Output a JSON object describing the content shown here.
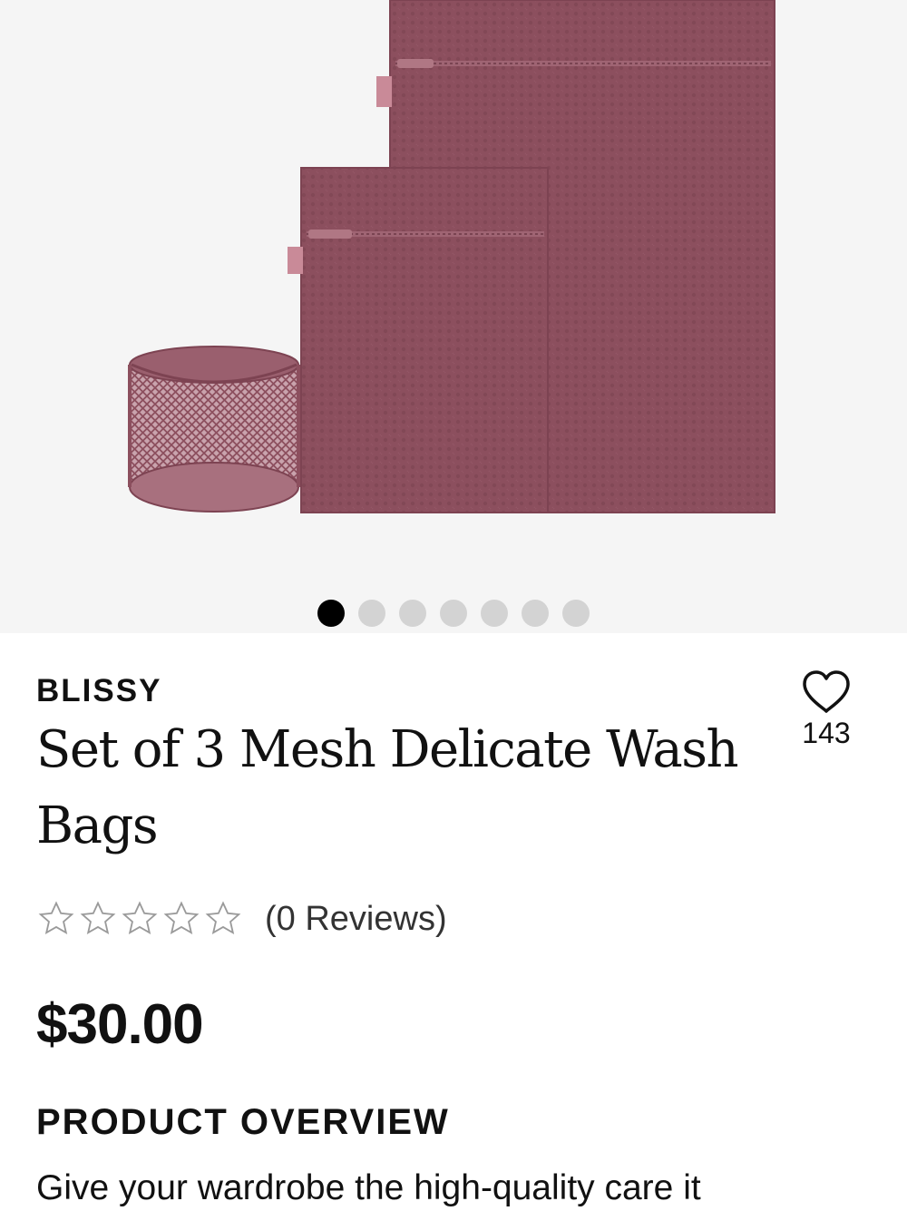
{
  "gallery": {
    "image_alt": "Set of 3 Mesh Delicate Wash Bags product photo",
    "product_color": "#8c4f5e",
    "background_color": "#f5f5f5",
    "slide_count": 7,
    "active_slide": 1
  },
  "product": {
    "brand": "BLISSY",
    "title": "Set of 3 Mesh Delicate Wash Bags",
    "wishlist_count": "143",
    "rating": 0,
    "reviews_label": "(0 Reviews)",
    "price": "$30.00"
  },
  "overview": {
    "heading": "PRODUCT OVERVIEW",
    "text": "Give your wardrobe the high-quality care it"
  }
}
